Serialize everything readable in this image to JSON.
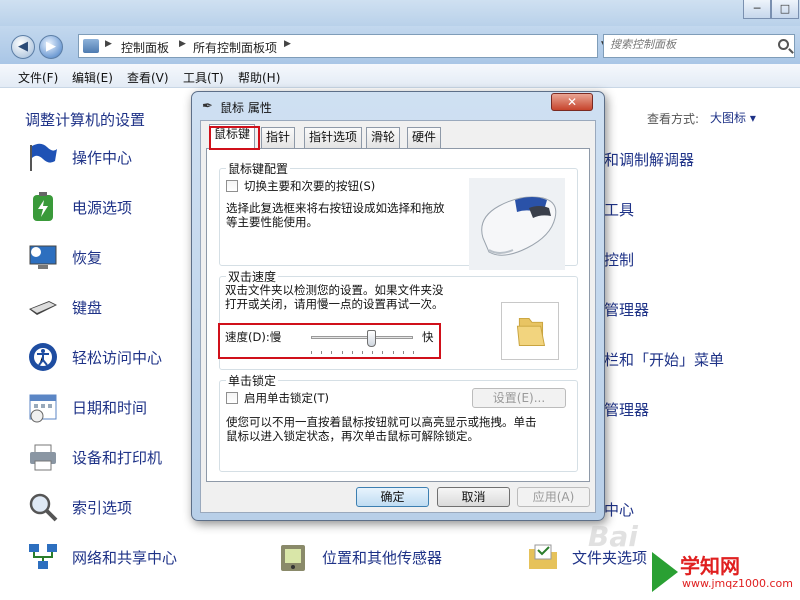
{
  "window": {
    "minimize_glyph": "─",
    "maximize_glyph": "□"
  },
  "address": {
    "back_glyph": "◀",
    "forward_glyph": "▶",
    "breadcrumb": [
      "控制面板",
      "所有控制面板项"
    ],
    "refresh_glyph": "↻",
    "search_placeholder": "搜索控制面板"
  },
  "menu": [
    "文件(F)",
    "编辑(E)",
    "查看(V)",
    "工具(T)",
    "帮助(H)"
  ],
  "content": {
    "title": "调整计算机的设置",
    "view_by_label": "查看方式:",
    "view_by_value": "大图标 ▾",
    "left_items": [
      "操作中心",
      "电源选项",
      "恢复",
      "键盘",
      "轻松访问中心",
      "日期和时间",
      "设备和打印机",
      "索引选项",
      "网络和共享中心"
    ],
    "mid_item": "位置和其他传感器",
    "right_partial": [
      "和调制解调器",
      "工具",
      "控制",
      "管理器",
      "栏和「开始」菜单",
      "管理器",
      "中心"
    ],
    "bottom_right_item": "文件夹选项"
  },
  "dialog": {
    "title_icon": "✒",
    "title": "鼠标 属性",
    "close_glyph": "✕",
    "tabs": [
      "鼠标键",
      "指针",
      "指针选项",
      "滑轮",
      "硬件"
    ],
    "group_buttons": {
      "title": "鼠标键配置",
      "checkbox_label": "切换主要和次要的按钮(S)",
      "description": [
        "选择此复选框来将右按钮设成如选择和拖放",
        "等主要性能使用。"
      ]
    },
    "group_double_click": {
      "title": "双击速度",
      "description": [
        "双击文件夹以检测您的设置。如果文件夹没",
        "打开或关闭，请用慢一点的设置再试一次。"
      ],
      "speed_label": "速度(D):慢",
      "speed_fast": "快",
      "speed_position": 0.6
    },
    "group_clicklock": {
      "title": "单击锁定",
      "checkbox_label": "启用单击锁定(T)",
      "settings_button": "设置(E)...",
      "description": [
        "使您可以不用一直按着鼠标按钮就可以高亮显示或拖拽。单击",
        "鼠标以进入锁定状态，再次单击鼠标可解除锁定。"
      ]
    },
    "buttons": {
      "ok": "确定",
      "cancel": "取消",
      "apply": "应用(A)"
    }
  },
  "watermark": {
    "baidu": "Bai",
    "logo_main": "学知网",
    "logo_url": "www.jmqz1000.com"
  }
}
